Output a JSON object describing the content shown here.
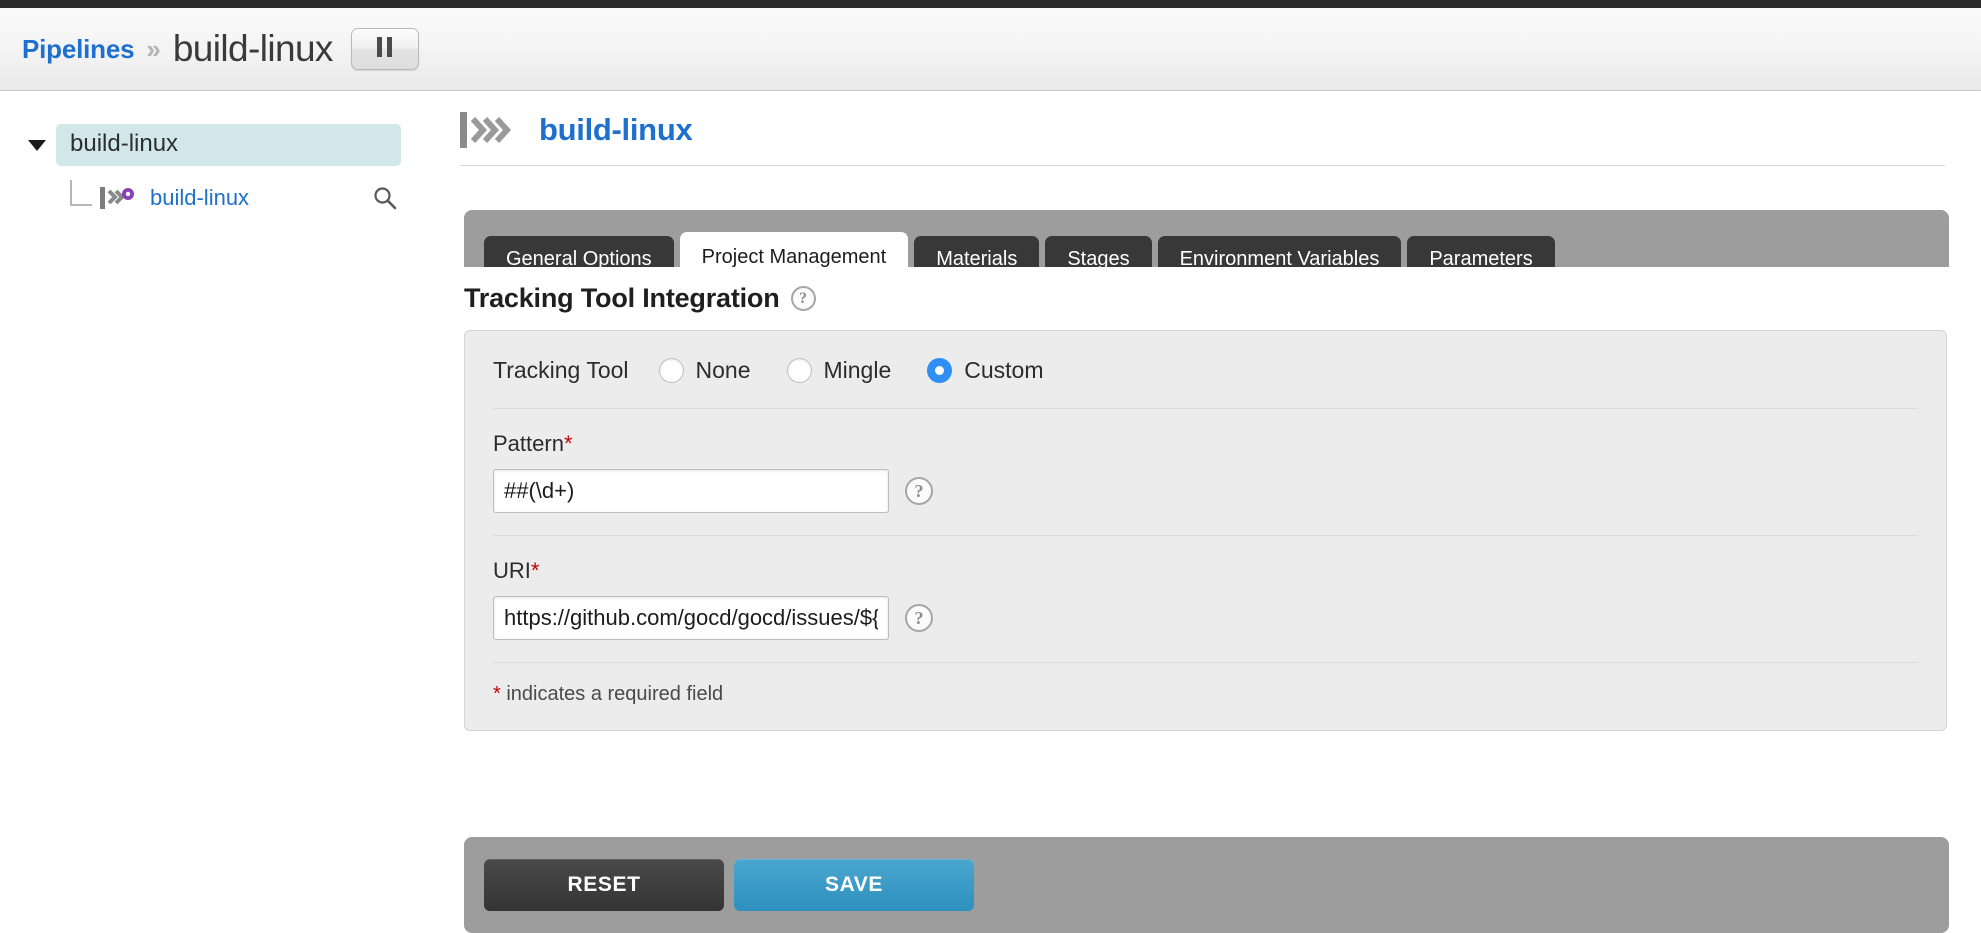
{
  "header": {
    "breadcrumb_link": "Pipelines",
    "breadcrumb_separator": "»",
    "breadcrumb_current": "build-linux",
    "pause_button_icon": "pause-icon"
  },
  "sidebar": {
    "tree": {
      "root_label": "build-linux",
      "child_label": "build-linux",
      "child_icon": "pipeline-group-icon",
      "search_icon": "search-icon",
      "caret_icon": "caret-down-icon"
    }
  },
  "main": {
    "page_title": "build-linux",
    "page_title_icon": "pipeline-icon",
    "tabs": [
      {
        "label": "General Options",
        "active": false
      },
      {
        "label": "Project Management",
        "active": true
      },
      {
        "label": "Materials",
        "active": false
      },
      {
        "label": "Stages",
        "active": false
      },
      {
        "label": "Environment Variables",
        "active": false
      },
      {
        "label": "Parameters",
        "active": false
      }
    ],
    "section": {
      "title": "Tracking Tool Integration",
      "help_icon": "question-mark-icon",
      "help_glyph": "?"
    },
    "tracking_tool": {
      "label": "Tracking Tool",
      "options": [
        {
          "label": "None",
          "selected": false
        },
        {
          "label": "Mingle",
          "selected": false
        },
        {
          "label": "Custom",
          "selected": true
        }
      ],
      "selected": "Custom"
    },
    "fields": [
      {
        "label": "Pattern",
        "required_marker": "*",
        "value": "##(\\d+)",
        "placeholder": "",
        "help_glyph": "?"
      },
      {
        "label": "URI",
        "required_marker": "*",
        "value": "https://github.com/gocd/gocd/issues/${ID}",
        "placeholder": "",
        "help_glyph": "?"
      }
    ],
    "required_note_marker": "*",
    "required_note_text": " indicates a required field",
    "actions": {
      "reset_label": "RESET",
      "save_label": "SAVE"
    }
  },
  "colors": {
    "accent_blue": "#1f6fce",
    "radio_selected": "#2f8ff5",
    "save_button": "#2e90bf",
    "tab_bar": "#9d9d9d",
    "tab_inactive": "#383838",
    "tree_highlight": "#d2e7ea",
    "required_red": "#c30000"
  }
}
